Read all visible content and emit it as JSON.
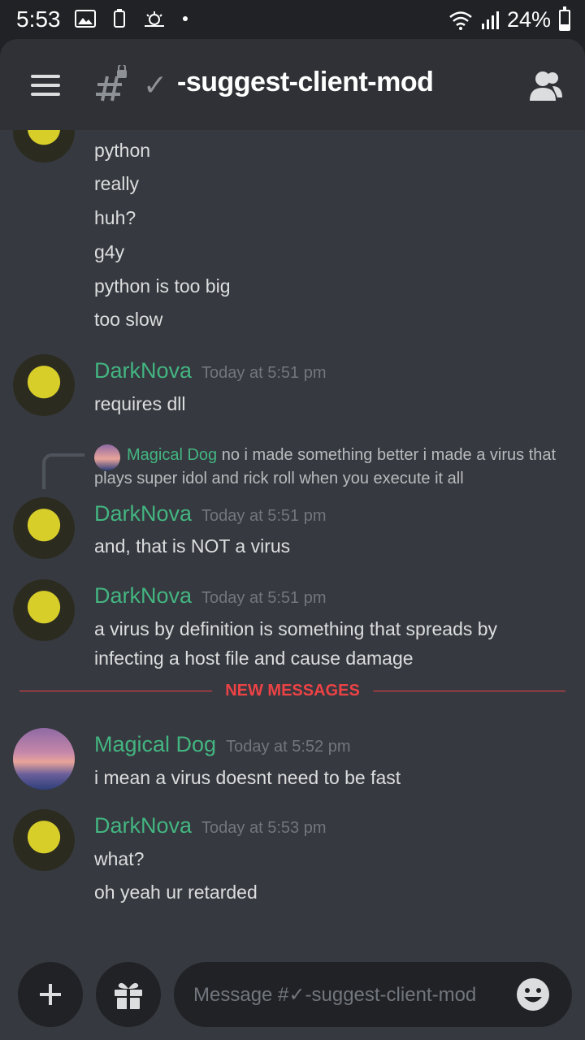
{
  "status_bar": {
    "time": "5:53",
    "battery": "24%",
    "battery_level": 0.24
  },
  "header": {
    "channel_emoji": "✓",
    "channel_name": "-suggest-client-mod"
  },
  "messages": {
    "continued_lines": [
      "python",
      "really",
      "huh?",
      "g4y",
      "python is too big",
      "too slow"
    ],
    "msg1": {
      "author": "DarkNova",
      "time": "Today at 5:51 pm",
      "lines": [
        "requires dll"
      ]
    },
    "reply": {
      "author": "Magical Dog",
      "text": "no  i made something better i made a virus that plays super idol and rick roll when you execute it all"
    },
    "msg2": {
      "author": "DarkNova",
      "time": "Today at 5:51 pm",
      "lines": [
        "and, that is NOT a virus"
      ]
    },
    "msg3": {
      "author": "DarkNova",
      "time": "Today at 5:51 pm",
      "lines": [
        "a virus by definition is something that spreads by",
        "infecting a host file and cause damage"
      ]
    },
    "new_messages_label": "NEW MESSAGES",
    "msg4": {
      "author": "Magical Dog",
      "time": "Today at 5:52 pm",
      "lines": [
        "i mean a virus doesnt need to be fast"
      ]
    },
    "msg5": {
      "author": "DarkNova",
      "time": "Today at 5:53 pm",
      "lines": [
        "what?",
        "oh yeah ur retarded"
      ]
    }
  },
  "composer": {
    "placeholder": "Message #✓-suggest-client-mod"
  },
  "colors": {
    "author_green": "#43b581",
    "new_messages_red": "#ed4245",
    "background": "#36393f",
    "header_bg": "#2f3136"
  }
}
